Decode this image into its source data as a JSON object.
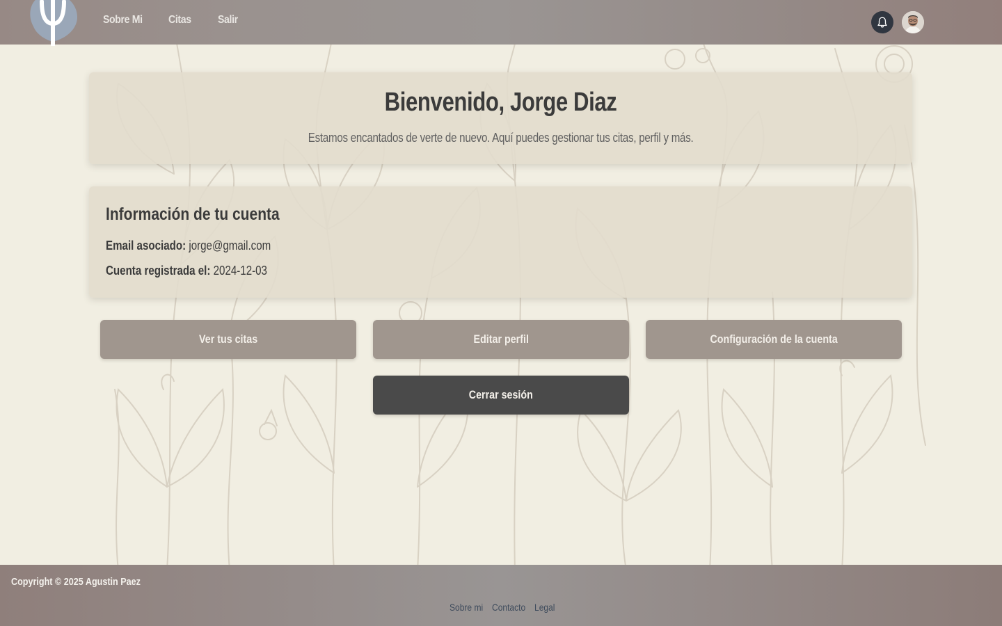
{
  "nav": {
    "links": [
      "Sobre Mi",
      "Citas",
      "Salir"
    ],
    "logo_icon": "psi-logo-icon",
    "notification_icon": "bell-icon",
    "avatar_icon": "user-avatar"
  },
  "welcome": {
    "title": "Bienvenido, Jorge Diaz",
    "subtitle": "Estamos encantados de verte de nuevo. Aquí puedes gestionar tus citas, perfil y más."
  },
  "account": {
    "heading": "Información de tu cuenta",
    "email_label": "Email asociado:",
    "email_value": "jorge@gmail.com",
    "registered_label": "Cuenta registrada el:",
    "registered_value": "2024-12-03"
  },
  "actions": {
    "view_appointments": "Ver tus citas",
    "edit_profile": "Editar perfil",
    "account_settings": "Configuración de la cuenta",
    "logout": "Cerrar sesión"
  },
  "footer": {
    "copyright": "Copyright © 2025 Agustin Paez",
    "links": [
      "Sobre mi",
      "Contacto",
      "Legal"
    ]
  },
  "colors": {
    "background": "#f1eee2",
    "card": "#e2dbcd",
    "button_light": "#a0968e",
    "button_dark": "#4a4a4a",
    "navbar": "#9a928f",
    "footer_link": "#3e4b5c"
  }
}
